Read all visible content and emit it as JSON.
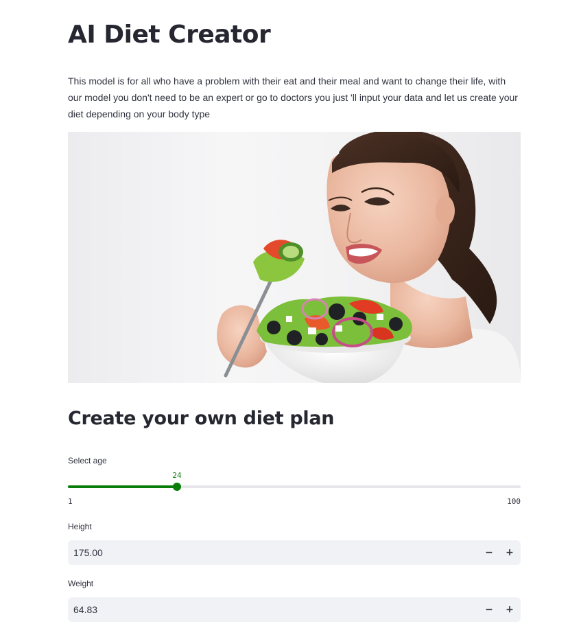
{
  "app": {
    "title": "AI Diet Creator",
    "intro": "This model is for all who have a problem with their eat and their meal and want to change their life, with our model you don't need to be an expert or go to doctors you just 'll input your data and let us create your diet depending on your body type"
  },
  "hero": {
    "subject": "woman eating salad"
  },
  "form": {
    "section_title": "Create your own diet plan",
    "age": {
      "label": "Select age",
      "value": 24,
      "min": 1,
      "max": 100,
      "min_label": "1",
      "max_label": "100",
      "value_label": "24"
    },
    "height": {
      "label": "Height",
      "value": "175.00",
      "minus": "−",
      "plus": "+"
    },
    "weight": {
      "label": "Weight",
      "value": "64.83",
      "minus": "−",
      "plus": "+"
    }
  },
  "colors": {
    "accent": "#0a7d0a",
    "input_bg": "#f0f2f6",
    "text": "#31333f"
  }
}
